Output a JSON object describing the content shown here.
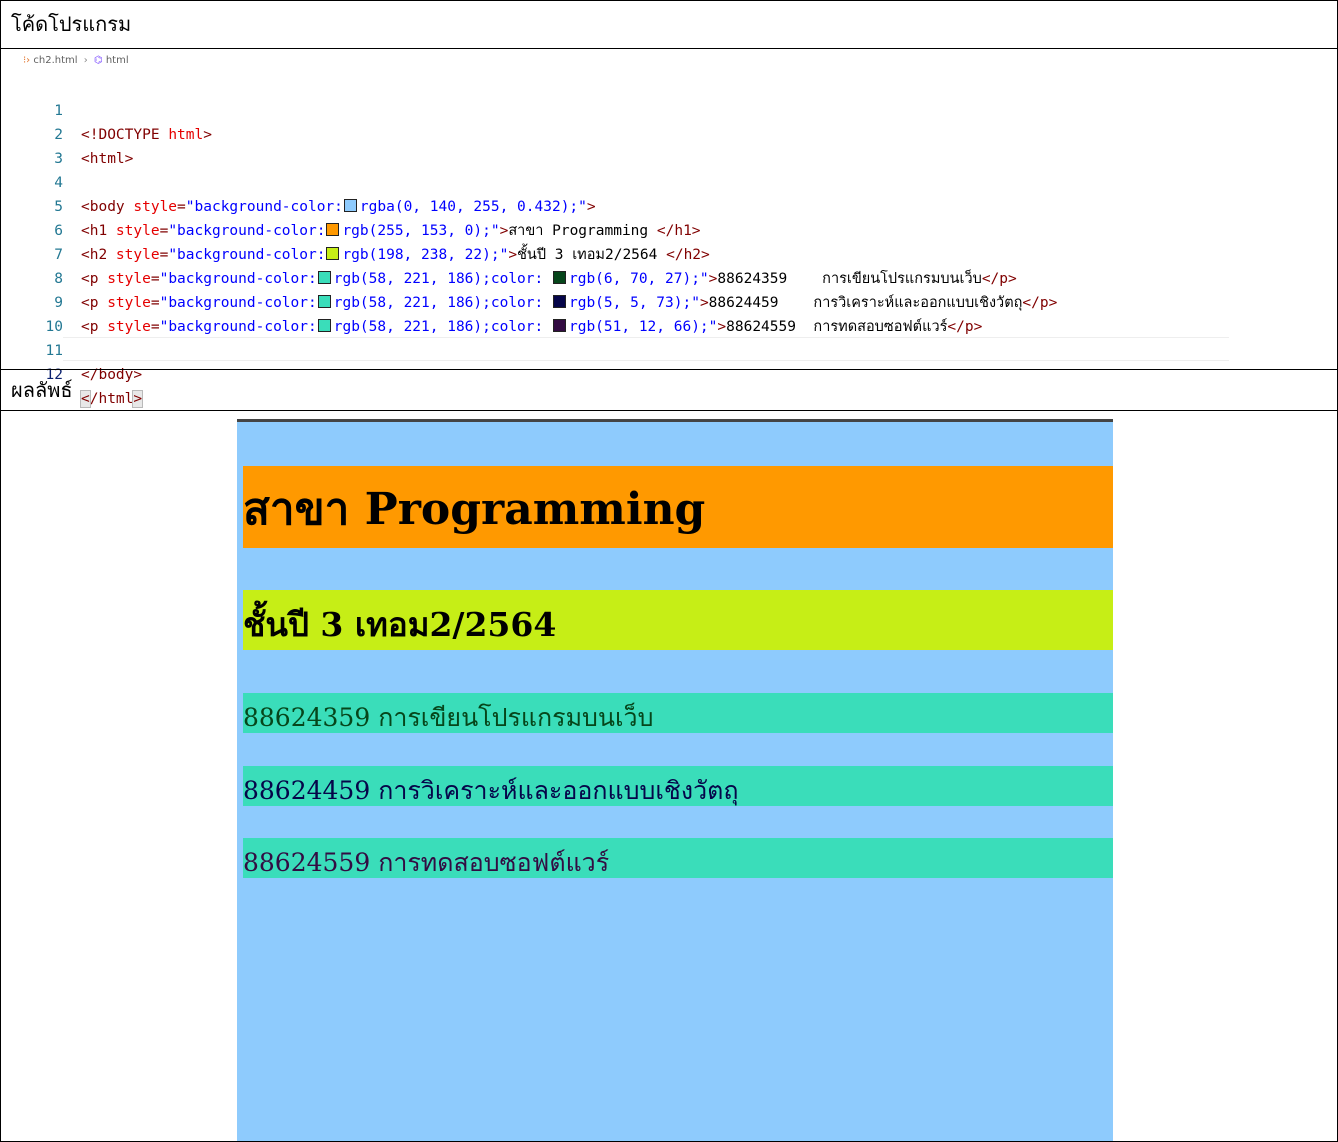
{
  "sections": {
    "code_label": "โค้ดโปรแกรม",
    "result_label": "ผลลัพธ์"
  },
  "editor": {
    "breadcrumb_file": "ch2.html",
    "breadcrumb_node": "html",
    "lines": [
      {
        "num": "1"
      },
      {
        "num": "2"
      },
      {
        "num": "3"
      },
      {
        "num": "4"
      },
      {
        "num": "5"
      },
      {
        "num": "6"
      },
      {
        "num": "7"
      },
      {
        "num": "8"
      },
      {
        "num": "9"
      },
      {
        "num": "10"
      },
      {
        "num": "11"
      },
      {
        "num": "12"
      }
    ],
    "doctype": "<!DOCTYPE ",
    "doctype_html": "html",
    "doctype_close": ">",
    "html_open": "<html>",
    "body_open_tag": "<body ",
    "style_attr": "style",
    "eq": "=",
    "body_style_a": "\"background-color:",
    "body_style_b": "rgba(0, 140, 255, 0.432);\"",
    "gt": ">",
    "h1_tag": "<h1 ",
    "h1_style_a": "\"background-color:",
    "h1_style_b": "rgb(255, 153, 0);\"",
    "h1_text": "สาขา Programming ",
    "h1_close": "</h1>",
    "h2_tag": "<h2 ",
    "h2_style_a": "\"background-color:",
    "h2_style_b": "rgb(198, 238, 22);\"",
    "h2_text": "ชั้นปี 3 เทอม2/2564 ",
    "h2_close": "</h2>",
    "p_tag": "<p ",
    "p_style_a": "\"background-color:",
    "p_style_bg": "rgb(58, 221, 186);color: ",
    "p1_color": "rgb(6, 70, 27);\"",
    "p1_text": "88624359    การเขียนโปรแกรมบนเว็บ",
    "p2_color": "rgb(5, 5, 73);\"",
    "p2_text": "88624459    การวิเคราะห์และออกแบบเชิงวัตถุ",
    "p3_color": "rgb(51, 12, 66);\"",
    "p3_text": "88624559  การทดสอบซอฟต์แวร์",
    "p_close": "</p>",
    "body_close": "</body>",
    "html_close_lt": "<",
    "html_close_mid": "/html",
    "html_close_gt": ">"
  },
  "colors": {
    "body_bg": "#8ecbfd",
    "h1_bg": "#ff9900",
    "h2_bg": "#c6ee16",
    "p_bg": "#3addba",
    "p1_fg": "#06461b",
    "p2_fg": "#050549",
    "p3_fg": "#330c42"
  },
  "result": {
    "h1": "สาขา Programming",
    "h2": "ชั้นปี 3 เทอม2/2564",
    "p1": "88624359 การเขียนโปรแกรมบนเว็บ",
    "p2": "88624459 การวิเคราะห์และออกแบบเชิงวัตถุ",
    "p3": "88624559 การทดสอบซอฟต์แวร์"
  }
}
